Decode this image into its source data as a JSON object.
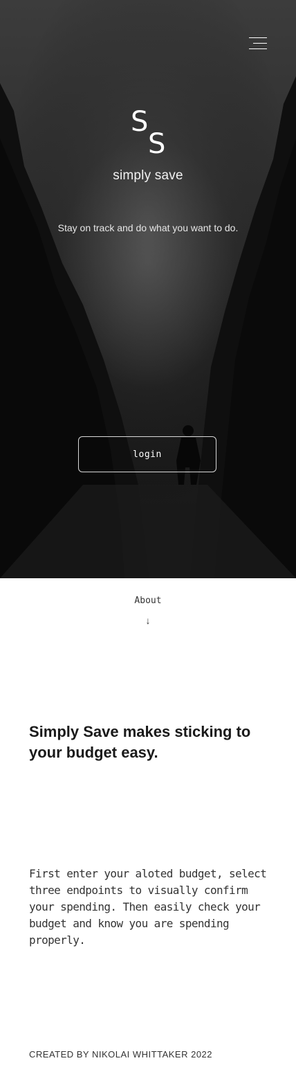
{
  "header": {
    "menu_icon": "hamburger-menu-icon"
  },
  "hero": {
    "logo_letter_top": "S",
    "logo_letter_bottom": "S",
    "app_name": "simply save",
    "tagline": "Stay on track and do what you want to do.",
    "login_label": "login"
  },
  "about": {
    "link_label": "About",
    "arrow": "↓",
    "arrow_icon": "arrow-down-icon"
  },
  "content": {
    "headline": "Simply Save makes sticking to your budget easy.",
    "description": "First enter your aloted budget, select three endpoints to visually confirm your spending. Then easily check your budget and know you are spending properly."
  },
  "footer": {
    "credit": "CREATED BY NIKOLAI WHITTAKER 2022"
  },
  "colors": {
    "hero_dark": "#141414",
    "hero_light": "#3c3c3c",
    "text_light": "#ffffff",
    "text_dark": "#1a1a1a",
    "page_background": "#ffffff"
  }
}
